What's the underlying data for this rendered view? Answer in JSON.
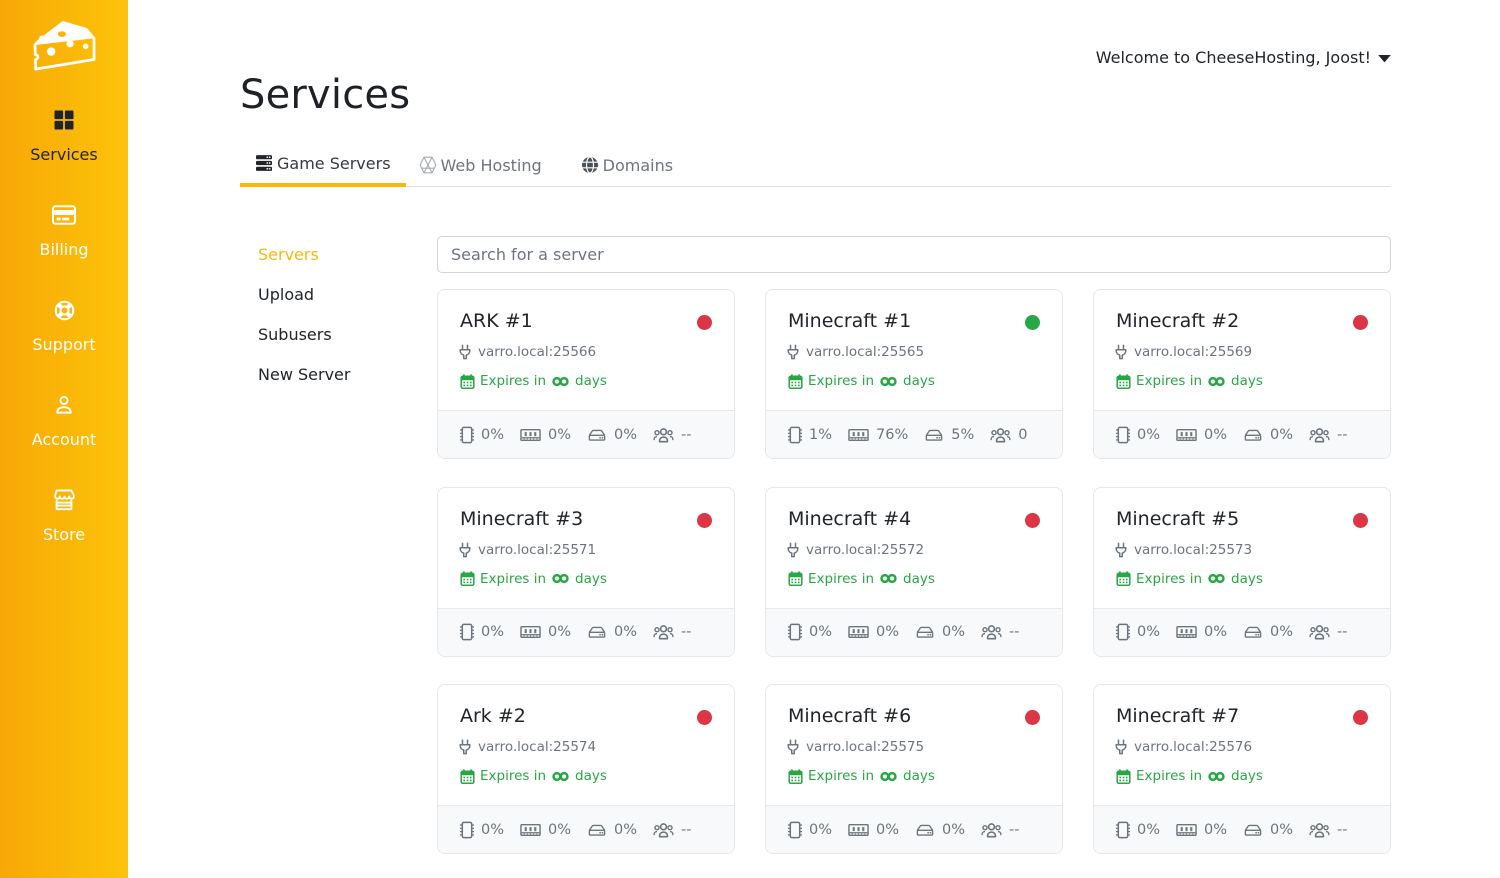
{
  "theme": {
    "sidebar_gradient": [
      "#f7a806",
      "#fdc30a"
    ],
    "accent_yellow": "#fcb70a",
    "green": "#28a745",
    "red": "#dc3545",
    "status_colors": {
      "online": "#28a745",
      "offline": "#dc3545"
    }
  },
  "sidebar": {
    "logo": "cheese-logo",
    "items": [
      {
        "label": "Services",
        "icon": "grid-icon",
        "active": true
      },
      {
        "label": "Billing",
        "icon": "credit-card-icon",
        "active": false
      },
      {
        "label": "Support",
        "icon": "life-buoy-icon",
        "active": false
      },
      {
        "label": "Account",
        "icon": "person-icon",
        "active": false
      },
      {
        "label": "Store",
        "icon": "shop-icon",
        "active": false
      }
    ]
  },
  "header": {
    "welcome_text": "Welcome to CheeseHosting, Joost!"
  },
  "page": {
    "title": "Services"
  },
  "tabs": [
    {
      "label": "Game Servers",
      "icon": "server-rack-icon",
      "active": true
    },
    {
      "label": "Web Hosting",
      "icon": "hexagon-globe-icon",
      "active": false
    },
    {
      "label": "Domains",
      "icon": "globe-icon",
      "active": false
    }
  ],
  "subnav": [
    {
      "label": "Servers",
      "active": true
    },
    {
      "label": "Upload",
      "active": false
    },
    {
      "label": "Subusers",
      "active": false
    },
    {
      "label": "New Server",
      "active": false
    }
  ],
  "search": {
    "placeholder": "Search for a server"
  },
  "stats_legend": {
    "cpu": "cpu-chip-icon",
    "memory": "ram-icon",
    "disk": "hdd-icon",
    "players": "people-icon"
  },
  "expiry": {
    "prefix": "Expires in",
    "infinity": "infinity-icon",
    "suffix": "days"
  },
  "cards": [
    {
      "title": "ARK #1",
      "status": "offline",
      "host": "varro.local:25566",
      "cpu": "0%",
      "memory": "0%",
      "disk": "0%",
      "players": "--"
    },
    {
      "title": "Minecraft #1",
      "status": "online",
      "host": "varro.local:25565",
      "cpu": "1%",
      "memory": "76%",
      "disk": "5%",
      "players": "0"
    },
    {
      "title": "Minecraft #2",
      "status": "offline",
      "host": "varro.local:25569",
      "cpu": "0%",
      "memory": "0%",
      "disk": "0%",
      "players": "--"
    },
    {
      "title": "Minecraft #3",
      "status": "offline",
      "host": "varro.local:25571",
      "cpu": "0%",
      "memory": "0%",
      "disk": "0%",
      "players": "--"
    },
    {
      "title": "Minecraft #4",
      "status": "offline",
      "host": "varro.local:25572",
      "cpu": "0%",
      "memory": "0%",
      "disk": "0%",
      "players": "--"
    },
    {
      "title": "Minecraft #5",
      "status": "offline",
      "host": "varro.local:25573",
      "cpu": "0%",
      "memory": "0%",
      "disk": "0%",
      "players": "--"
    },
    {
      "title": "Ark #2",
      "status": "offline",
      "host": "varro.local:25574",
      "cpu": "0%",
      "memory": "0%",
      "disk": "0%",
      "players": "--"
    },
    {
      "title": "Minecraft #6",
      "status": "offline",
      "host": "varro.local:25575",
      "cpu": "0%",
      "memory": "0%",
      "disk": "0%",
      "players": "--"
    },
    {
      "title": "Minecraft #7",
      "status": "offline",
      "host": "varro.local:25576",
      "cpu": "0%",
      "memory": "0%",
      "disk": "0%",
      "players": "--"
    }
  ]
}
